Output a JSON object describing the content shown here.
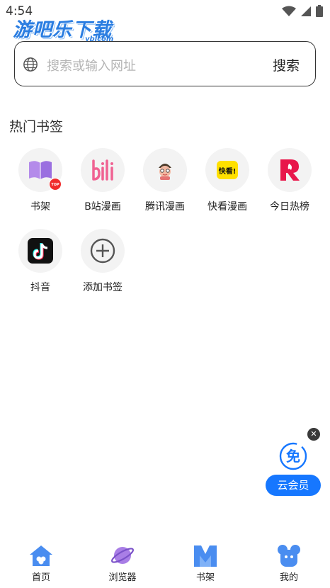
{
  "status": {
    "time": "4:54"
  },
  "logo": {
    "main": "游吧乐下载",
    "sub": "yblcom"
  },
  "search": {
    "placeholder": "搜索或输入网址",
    "button_label": "搜索"
  },
  "section_title": "热门书签",
  "bookmarks": [
    {
      "label": "书架",
      "icon": "bookshelf-icon",
      "badge": "TOP"
    },
    {
      "label": "B站漫画",
      "icon": "bilibili-comics-icon"
    },
    {
      "label": "腾讯漫画",
      "icon": "tencent-comics-icon"
    },
    {
      "label": "快看漫画",
      "icon": "kuaikan-comics-icon",
      "icon_text": "快看!"
    },
    {
      "label": "今日热榜",
      "icon": "today-hot-icon"
    },
    {
      "label": "抖音",
      "icon": "douyin-icon"
    },
    {
      "label": "添加书签",
      "icon": "add-bookmark-icon"
    }
  ],
  "floating": {
    "icon_text": "免",
    "label": "云会员"
  },
  "nav": [
    {
      "label": "首页",
      "icon": "home-icon"
    },
    {
      "label": "浏览器",
      "icon": "planet-browser-icon"
    },
    {
      "label": "书架",
      "icon": "book-icon"
    },
    {
      "label": "我的",
      "icon": "profile-icon"
    }
  ],
  "colors": {
    "accent": "#1677ff",
    "logo": "#2a7de1",
    "purple": "#a97ee6",
    "nav_blue": "#4a8df0"
  }
}
